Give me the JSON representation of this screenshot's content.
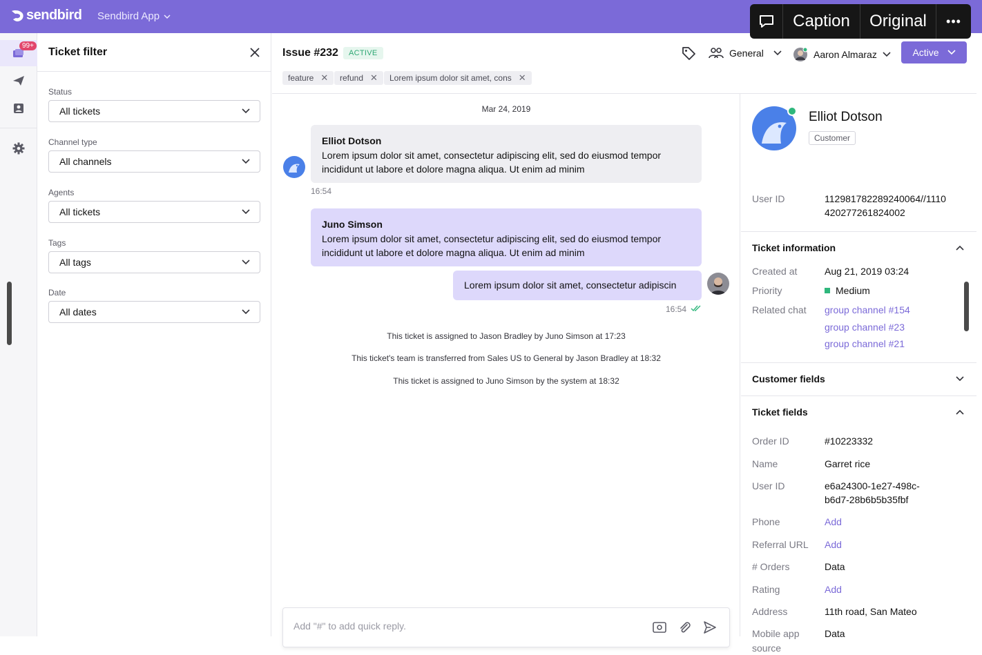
{
  "topbar": {
    "brand": "sendbird",
    "app_name": "Sendbird App"
  },
  "overlay": {
    "caption": "Caption",
    "original": "Original",
    "more": "•••"
  },
  "rail": {
    "badge": "99+",
    "items": [
      "tickets-icon",
      "send-icon",
      "contacts-icon",
      "settings-icon"
    ]
  },
  "filter": {
    "title": "Ticket filter",
    "fields": [
      {
        "label": "Status",
        "value": "All tickets"
      },
      {
        "label": "Channel type",
        "value": "All channels"
      },
      {
        "label": "Agents",
        "value": "All tickets"
      },
      {
        "label": "Tags",
        "value": "All tags"
      },
      {
        "label": "Date",
        "value": "All dates"
      }
    ]
  },
  "issue": {
    "title": "Issue #232",
    "status": "ACTIVE",
    "tags": [
      "feature",
      "refund",
      "Lorem ipsum dolor sit amet, cons"
    ],
    "team": "General",
    "agent": "Aaron Almaraz",
    "state_button": "Active"
  },
  "chat": {
    "date": "Mar 24, 2019",
    "messages": [
      {
        "sender": "Elliot Dotson",
        "text": "Lorem ipsum dolor sit amet, consectetur adipiscing elit, sed do eiusmod tempor incididunt ut labore et dolore magna aliqua. Ut enim ad minim",
        "time": "16:54"
      },
      {
        "sender": "Juno Simson",
        "text": "Lorem ipsum dolor sit amet, consectetur adipiscing elit, sed do eiusmod tempor incididunt ut labore et dolore magna aliqua. Ut enim ad minim"
      },
      {
        "text": "Lorem ipsum dolor sit amet, consectetur adipiscin",
        "time": "16:54"
      }
    ],
    "system": [
      "This ticket is assigned to Jason Bradley by Juno Simson at 17:23",
      "This ticket's team is transferred from Sales US to General by Jason Bradley  at 18:32",
      "This ticket is assigned to Juno Simson by the system  at 18:32"
    ],
    "composer_placeholder": "Add \"#\" to add quick reply."
  },
  "customer": {
    "name": "Elliot Dotson",
    "role": "Customer",
    "user_id_label": "User ID",
    "user_id_line1": "112981782289240064//1110",
    "user_id_line2": "420277261824002"
  },
  "ticket_info": {
    "title": "Ticket information",
    "created_label": "Created at",
    "created_value": "Aug 21, 2019 03:24",
    "priority_label": "Priority",
    "priority_value": "Medium",
    "priority_color": "#2fb77c",
    "related_label": "Related chat",
    "related": [
      "group channel #154",
      "group channel #23",
      "group channel #21"
    ]
  },
  "customer_fields": {
    "title": "Customer fields"
  },
  "ticket_fields": {
    "title": "Ticket fields",
    "rows": [
      {
        "label": "Order ID",
        "value": "#10223332"
      },
      {
        "label": "Name",
        "value": "Garret rice"
      },
      {
        "label": "User ID",
        "value": "e6a24300-1e27-498c-",
        "value2": "b6d7-28b6b5b35fbf"
      },
      {
        "label": "Phone",
        "value": "Add"
      },
      {
        "label": "Referral URL",
        "value": "Add"
      },
      {
        "label": "# Orders",
        "value": "Data"
      },
      {
        "label": "Rating",
        "value": "Add"
      },
      {
        "label": "Address",
        "value": "11th road, San Mateo"
      },
      {
        "label": "Mobile app",
        "label2": "source",
        "value": "Data"
      }
    ]
  },
  "colors": {
    "brand": "#7b6ad8",
    "active_green": "#2fa874"
  }
}
